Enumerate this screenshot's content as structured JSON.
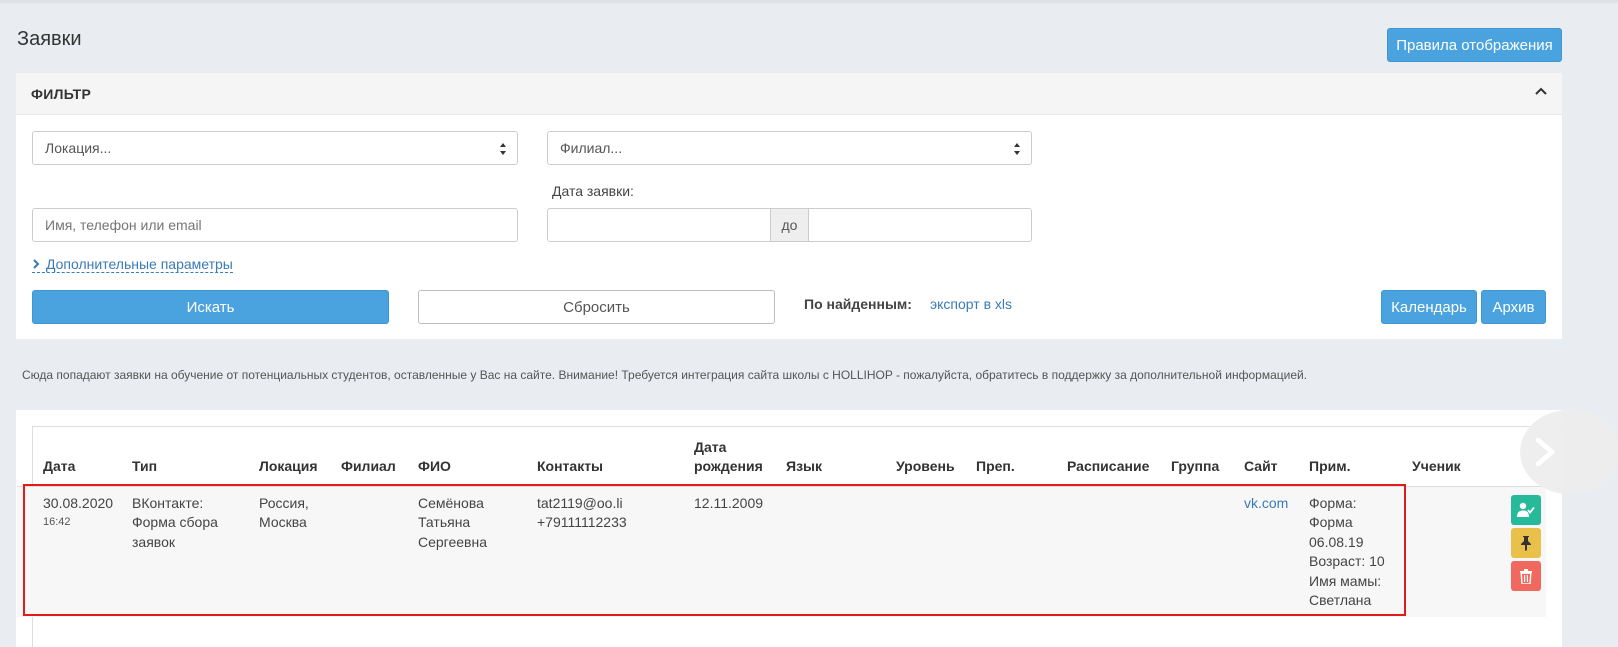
{
  "page": {
    "title": "Заявки"
  },
  "header": {
    "rules_button": "Правила отображения"
  },
  "filter": {
    "title": "ФИЛЬТР",
    "location_select": "Локация...",
    "branch_select": "Филиал...",
    "date_label": "Дата заявки:",
    "search_placeholder": "Имя, телефон или email",
    "date_to": "до",
    "more_params": "Дополнительные параметры",
    "search_button": "Искать",
    "reset_button": "Сбросить",
    "found_label": "По найденным:",
    "export_link": "экспорт в xls",
    "calendar_button": "Календарь",
    "archive_button": "Архив"
  },
  "info_text": "Сюда попадают заявки на обучение от потенциальных студентов, оставленные у Вас на сайте. Внимание! Требуется интеграция сайта школы с HOLLIHOP - пожалуйста, обратитесь в поддержку за дополнительной информацией.",
  "table": {
    "headers": {
      "date": "Дата",
      "type": "Тип",
      "location": "Локация",
      "branch": "Филиал",
      "fio": "ФИО",
      "contacts": "Контакты",
      "birth_1": "Дата",
      "birth_2": "рождения",
      "language": "Язык",
      "level": "Уровень",
      "teacher": "Преп.",
      "schedule": "Расписание",
      "group": "Группа",
      "site": "Сайт",
      "note": "Прим.",
      "student": "Ученик"
    },
    "rows": [
      {
        "date": "30.08.2020",
        "time": "16:42",
        "type_1": "ВКонтакте:",
        "type_2": "Форма сбора",
        "type_3": "заявок",
        "location_1": "Россия,",
        "location_2": "Москва",
        "fio_1": "Семёнова",
        "fio_2": "Татьяна",
        "fio_3": "Сергеевна",
        "email": "tat2119@oo.li",
        "phone": "+79111112233",
        "birth": "12.11.2009",
        "site": "vk.com",
        "note_1": "Форма:",
        "note_2": "Форма",
        "note_3": "06.08.19",
        "note_4": "Возраст: 10",
        "note_5": "Имя мамы:",
        "note_6": "Светлана"
      }
    ]
  },
  "colors": {
    "primary": "#4aa3df",
    "highlight": "#e21a1a",
    "green": "#26b99a",
    "yellow": "#e9c04a",
    "red": "#f0695f",
    "link": "#3a7ab7"
  }
}
